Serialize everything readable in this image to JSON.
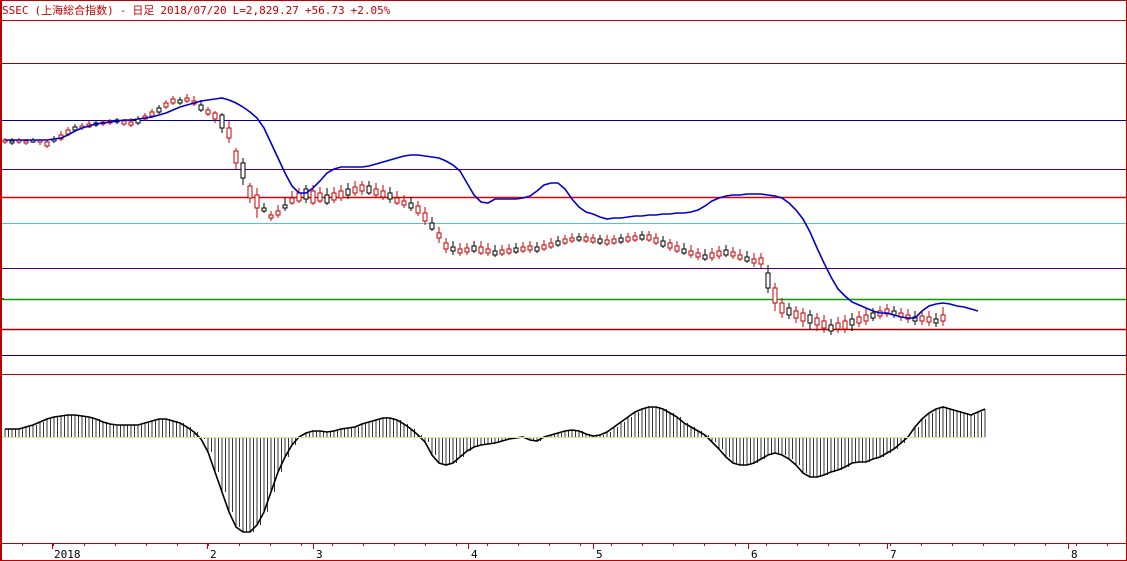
{
  "header": {
    "symbol": "SSEC",
    "name": "(上海総合指数)",
    "sep": "-",
    "period": "日足",
    "date": "2018/07/20",
    "last": "L=2,829.27",
    "change": "+56.73",
    "change_pct": "+2.05%"
  },
  "colors": {
    "frame": "#c00000",
    "up": "#c00000",
    "down": "#000000",
    "ma": "#0000cc",
    "histogram": "#000000"
  },
  "chart_data": [
    {
      "type": "candlestick",
      "title": "",
      "x_labels": [
        "2018",
        "2",
        "3",
        "4",
        "5",
        "6",
        "7",
        "8"
      ],
      "horizontal_lines": [
        {
          "color": "#a00000"
        },
        {
          "color": "#0000a0"
        },
        {
          "color": "#500070"
        },
        {
          "color": "#e00000"
        },
        {
          "color": "#40d0d0"
        },
        {
          "color": "#500070"
        },
        {
          "color": "#00a000"
        },
        {
          "color": "#a00000"
        },
        {
          "color": "#0000a0"
        }
      ],
      "moving_average": [
        3,
        3,
        3,
        3,
        3,
        3,
        3,
        4,
        5,
        8,
        12,
        15,
        17,
        19,
        20,
        21,
        22,
        23,
        23,
        24,
        25,
        26,
        28,
        30,
        33,
        36,
        38,
        40,
        42,
        43,
        44,
        45,
        43,
        40,
        36,
        31,
        25,
        15,
        0,
        -15,
        -30,
        -43,
        -50,
        -50,
        -45,
        -38,
        -30,
        -26,
        -24,
        -24,
        -24,
        -24,
        -23,
        -21,
        -19,
        -17,
        -15,
        -13,
        -12,
        -12,
        -13,
        -14,
        -15,
        -18,
        -22,
        -28,
        -40,
        -52,
        -59,
        -60,
        -56,
        -56,
        -56,
        -56,
        -55,
        -53,
        -48,
        -42,
        -40,
        -40,
        -46,
        -56,
        -64,
        -69,
        -71,
        -74,
        -76,
        -75,
        -75,
        -74,
        -73,
        -73,
        -72,
        -72,
        -71,
        -71,
        -70,
        -70,
        -69,
        -67,
        -63,
        -58,
        -55,
        -53,
        -52,
        -52,
        -51,
        -51,
        -51,
        -52,
        -53,
        -55,
        -60,
        -67,
        -76,
        -89,
        -105,
        -120,
        -134,
        -146,
        -153,
        -159,
        -162,
        -165,
        -168,
        -170,
        -170,
        -172,
        -174,
        -175,
        -175,
        -168,
        -163,
        -161,
        -160,
        -161,
        -163,
        -164,
        -166,
        -168
      ],
      "candles": [
        [
          3,
          5,
          1,
          -1
        ],
        [
          2,
          5,
          0,
          -2
        ],
        [
          3,
          5,
          1,
          -1
        ],
        [
          2,
          4,
          0,
          -2
        ],
        [
          3,
          5,
          1,
          0
        ],
        [
          3,
          4,
          1,
          -2
        ],
        [
          1,
          3,
          -3,
          -5
        ],
        [
          4,
          7,
          2,
          0
        ],
        [
          8,
          12,
          4,
          2
        ],
        [
          13,
          16,
          9,
          7
        ],
        [
          16,
          19,
          13,
          11
        ],
        [
          17,
          20,
          15,
          13
        ],
        [
          19,
          22,
          16,
          15
        ],
        [
          20,
          22,
          18,
          16
        ],
        [
          21,
          23,
          19,
          17
        ],
        [
          22,
          24,
          20,
          18
        ],
        [
          23,
          25,
          21,
          19
        ],
        [
          22,
          24,
          19,
          17
        ],
        [
          21,
          25,
          18,
          16
        ],
        [
          24,
          27,
          20,
          18
        ],
        [
          27,
          30,
          24,
          22
        ],
        [
          31,
          34,
          27,
          25
        ],
        [
          35,
          38,
          31,
          29
        ],
        [
          40,
          43,
          36,
          34
        ],
        [
          44,
          47,
          40,
          38
        ],
        [
          43,
          46,
          40,
          38
        ],
        [
          45,
          49,
          42,
          40
        ],
        [
          42,
          47,
          39,
          37
        ],
        [
          38,
          43,
          33,
          31
        ],
        [
          33,
          36,
          29,
          27
        ],
        [
          30,
          32,
          24,
          20
        ],
        [
          28,
          30,
          15,
          10
        ],
        [
          15,
          22,
          5,
          0
        ],
        [
          -8,
          -5,
          -20,
          -26
        ],
        [
          -20,
          -15,
          -35,
          -42
        ],
        [
          -43,
          -40,
          -55,
          -60
        ],
        [
          -52,
          -45,
          -65,
          -75
        ],
        [
          -65,
          -60,
          -68,
          -70
        ],
        [
          -72,
          -68,
          -75,
          -78
        ],
        [
          -68,
          -62,
          -72,
          -75
        ],
        [
          -62,
          -55,
          -65,
          -68
        ],
        [
          -55,
          -48,
          -60,
          -62
        ],
        [
          -50,
          -45,
          -58,
          -60
        ],
        [
          -46,
          -42,
          -56,
          -60
        ],
        [
          -48,
          -42,
          -60,
          -62
        ],
        [
          -50,
          -44,
          -58,
          -60
        ],
        [
          -52,
          -45,
          -60,
          -62
        ],
        [
          -50,
          -44,
          -57,
          -60
        ],
        [
          -48,
          -42,
          -55,
          -58
        ],
        [
          -46,
          -40,
          -52,
          -56
        ],
        [
          -44,
          -38,
          -50,
          -53
        ],
        [
          -42,
          -38,
          -48,
          -52
        ],
        [
          -43,
          -38,
          -50,
          -52
        ],
        [
          -46,
          -40,
          -52,
          -55
        ],
        [
          -48,
          -42,
          -54,
          -57
        ],
        [
          -50,
          -44,
          -56,
          -60
        ],
        [
          -55,
          -48,
          -60,
          -62
        ],
        [
          -58,
          -52,
          -62,
          -65
        ],
        [
          -60,
          -54,
          -65,
          -68
        ],
        [
          -63,
          -58,
          -70,
          -73
        ],
        [
          -70,
          -64,
          -78,
          -82
        ],
        [
          -80,
          -74,
          -86,
          -88
        ],
        [
          -90,
          -84,
          -95,
          -100
        ],
        [
          -100,
          -95,
          -106,
          -110
        ],
        [
          -104,
          -98,
          -108,
          -112
        ],
        [
          -106,
          -100,
          -110,
          -113
        ],
        [
          -105,
          -100,
          -109,
          -112
        ],
        [
          -103,
          -98,
          -108,
          -110
        ],
        [
          -104,
          -98,
          -110,
          -112
        ],
        [
          -106,
          -100,
          -110,
          -113
        ],
        [
          -108,
          -102,
          -112,
          -114
        ],
        [
          -107,
          -102,
          -111,
          -113
        ],
        [
          -106,
          -101,
          -110,
          -112
        ],
        [
          -105,
          -100,
          -109,
          -111
        ],
        [
          -104,
          -99,
          -108,
          -110
        ],
        [
          -103,
          -98,
          -107,
          -110
        ],
        [
          -104,
          -99,
          -108,
          -110
        ],
        [
          -102,
          -97,
          -106,
          -108
        ],
        [
          -100,
          -95,
          -104,
          -106
        ],
        [
          -98,
          -93,
          -102,
          -104
        ],
        [
          -96,
          -92,
          -100,
          -102
        ],
        [
          -95,
          -90,
          -98,
          -100
        ],
        [
          -94,
          -90,
          -97,
          -99
        ],
        [
          -94,
          -90,
          -98,
          -100
        ],
        [
          -95,
          -91,
          -99,
          -101
        ],
        [
          -96,
          -92,
          -100,
          -102
        ],
        [
          -97,
          -92,
          -101,
          -103
        ],
        [
          -96,
          -92,
          -100,
          -102
        ],
        [
          -95,
          -91,
          -99,
          -101
        ],
        [
          -94,
          -90,
          -98,
          -100
        ],
        [
          -93,
          -89,
          -97,
          -99
        ],
        [
          -92,
          -88,
          -96,
          -98
        ],
        [
          -92,
          -88,
          -97,
          -99
        ],
        [
          -95,
          -90,
          -100,
          -102
        ],
        [
          -98,
          -93,
          -103,
          -105
        ],
        [
          -100,
          -96,
          -105,
          -108
        ],
        [
          -103,
          -98,
          -108,
          -110
        ],
        [
          -106,
          -100,
          -110,
          -112
        ],
        [
          -108,
          -102,
          -112,
          -115
        ],
        [
          -110,
          -105,
          -114,
          -117
        ],
        [
          -112,
          -106,
          -116,
          -118
        ],
        [
          -110,
          -105,
          -115,
          -118
        ],
        [
          -108,
          -103,
          -113,
          -116
        ],
        [
          -107,
          -102,
          -112,
          -114
        ],
        [
          -109,
          -104,
          -113,
          -116
        ],
        [
          -112,
          -106,
          -116,
          -118
        ],
        [
          -114,
          -108,
          -118,
          -120
        ],
        [
          -116,
          -110,
          -120,
          -124
        ],
        [
          -115,
          -110,
          -121,
          -125
        ],
        [
          -130,
          -122,
          -145,
          -150
        ],
        [
          -145,
          -140,
          -160,
          -168
        ],
        [
          -160,
          -155,
          -170,
          -175
        ],
        [
          -165,
          -160,
          -172,
          -176
        ],
        [
          -168,
          -163,
          -175,
          -180
        ],
        [
          -170,
          -165,
          -178,
          -184
        ],
        [
          -172,
          -167,
          -180,
          -186
        ],
        [
          -175,
          -170,
          -182,
          -188
        ],
        [
          -178,
          -172,
          -185,
          -190
        ],
        [
          -182,
          -176,
          -188,
          -192
        ],
        [
          -180,
          -174,
          -186,
          -190
        ],
        [
          -178,
          -172,
          -186,
          -190
        ],
        [
          -176,
          -170,
          -182,
          -188
        ],
        [
          -174,
          -168,
          -180,
          -184
        ],
        [
          -172,
          -166,
          -178,
          -182
        ],
        [
          -170,
          -165,
          -175,
          -178
        ],
        [
          -168,
          -163,
          -173,
          -176
        ],
        [
          -166,
          -161,
          -171,
          -174
        ],
        [
          -168,
          -163,
          -172,
          -175
        ],
        [
          -170,
          -165,
          -174,
          -178
        ],
        [
          -172,
          -166,
          -176,
          -180
        ],
        [
          -174,
          -168,
          -178,
          -182
        ],
        [
          -173,
          -168,
          -178,
          -182
        ],
        [
          -174,
          -168,
          -179,
          -183
        ],
        [
          -176,
          -170,
          -180,
          -184
        ],
        [
          -172,
          -164,
          -178,
          -183
        ]
      ],
      "oscillator": [
        8,
        8,
        8,
        10,
        12,
        15,
        18,
        20,
        21,
        22,
        22,
        21,
        20,
        18,
        15,
        13,
        12,
        12,
        12,
        12,
        14,
        16,
        18,
        18,
        16,
        14,
        10,
        5,
        -2,
        -15,
        -35,
        -55,
        -75,
        -90,
        -95,
        -95,
        -88,
        -75,
        -55,
        -35,
        -20,
        -8,
        0,
        4,
        6,
        6,
        5,
        6,
        8,
        9,
        10,
        13,
        15,
        17,
        19,
        19,
        17,
        13,
        8,
        2,
        -5,
        -18,
        -26,
        -28,
        -26,
        -20,
        -14,
        -10,
        -8,
        -7,
        -6,
        -4,
        -2,
        -1,
        0,
        -3,
        -4,
        0,
        2,
        4,
        6,
        7,
        6,
        3,
        1,
        2,
        5,
        10,
        15,
        20,
        25,
        28,
        30,
        30,
        28,
        24,
        20,
        14,
        10,
        6,
        2,
        -5,
        -12,
        -20,
        -26,
        -28,
        -28,
        -26,
        -22,
        -18,
        -16,
        -18,
        -22,
        -28,
        -36,
        -40,
        -40,
        -38,
        -35,
        -33,
        -30,
        -26,
        -25,
        -25,
        -22,
        -20,
        -16,
        -12,
        -6,
        0,
        10,
        18,
        24,
        28,
        30,
        28,
        26,
        24,
        22,
        25,
        28
      ]
    }
  ]
}
